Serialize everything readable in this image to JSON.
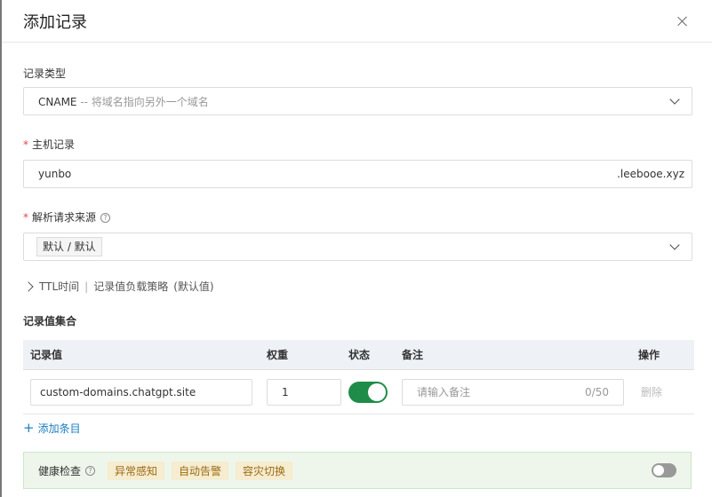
{
  "dialog": {
    "title": "添加记录"
  },
  "record_type": {
    "label": "记录类型",
    "value": "CNAME",
    "description": "-- 将域名指向另外一个域名"
  },
  "host_record": {
    "label": "主机记录",
    "required_mark": "*",
    "value": "yunbo",
    "suffix": ".leebooe.xyz"
  },
  "resolve_source": {
    "label": "解析请求来源",
    "required_mark": "*",
    "help": "?",
    "value": "默认 / 默认"
  },
  "advanced": {
    "ttl": "TTL时间",
    "separator": "|",
    "strategy": "记录值负载策略",
    "strategy_default": "(默认值)"
  },
  "record_set": {
    "label": "记录值集合",
    "columns": [
      "记录值",
      "权重",
      "状态",
      "备注",
      "操作"
    ],
    "rows": [
      {
        "value": "custom-domains.chatgpt.site",
        "weight": "1",
        "status": "on",
        "note_placeholder": "请输入备注",
        "note_count": "0/50",
        "action": "删除"
      }
    ],
    "add_label": "添加条目"
  },
  "health": {
    "label": "健康检查",
    "help": "?",
    "badges": [
      "异常感知",
      "自动告警",
      "容灾切换"
    ],
    "enabled": false
  },
  "colors": {
    "switch_on": "#1f8c4a",
    "link": "#1b7fbf",
    "required": "#e54545",
    "health_bg": "#eef6ec"
  }
}
